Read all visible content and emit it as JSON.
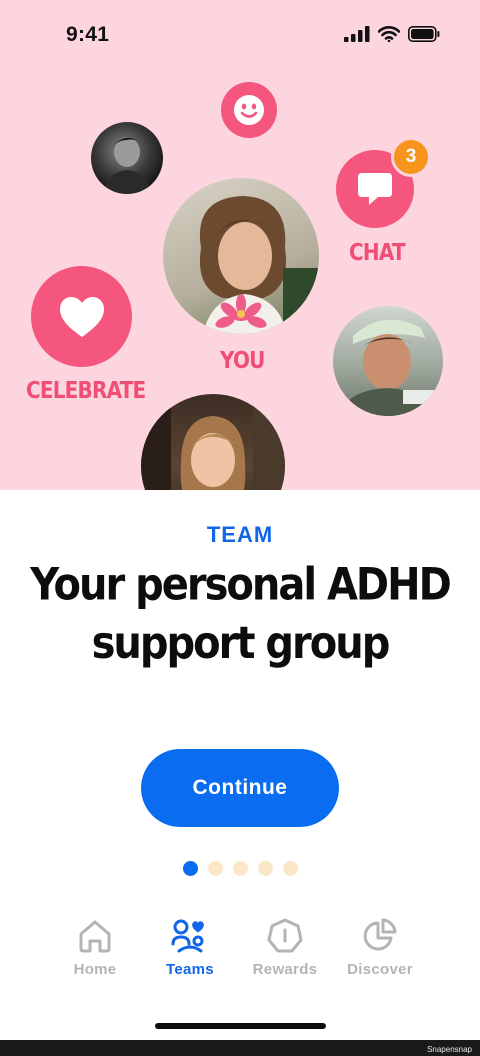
{
  "status_bar": {
    "time": "9:41",
    "icons": [
      "signal-icon",
      "wifi-icon",
      "battery-icon"
    ]
  },
  "hero": {
    "chat_label": "CHAT",
    "chat_badge": "3",
    "you_label": "YOU",
    "celebrate_label": "CELEBRATE",
    "colors": {
      "background": "#fdd5df",
      "accent": "#f5567d",
      "badge": "#f7941d"
    }
  },
  "content": {
    "eyebrow": "TEAM",
    "headline_line1": "Your personal ADHD",
    "headline_line2": "support group"
  },
  "continue_button": {
    "label": "Continue",
    "color": "#0a6cf1"
  },
  "pagination": {
    "total": 5,
    "current": 1
  },
  "tabbar": {
    "items": [
      {
        "label": "Home",
        "icon": "home-icon",
        "active": false
      },
      {
        "label": "Teams",
        "icon": "teams-icon",
        "active": true
      },
      {
        "label": "Rewards",
        "icon": "rewards-icon",
        "active": false
      },
      {
        "label": "Discover",
        "icon": "discover-icon",
        "active": false
      }
    ]
  },
  "watermark": "Snapensnap"
}
